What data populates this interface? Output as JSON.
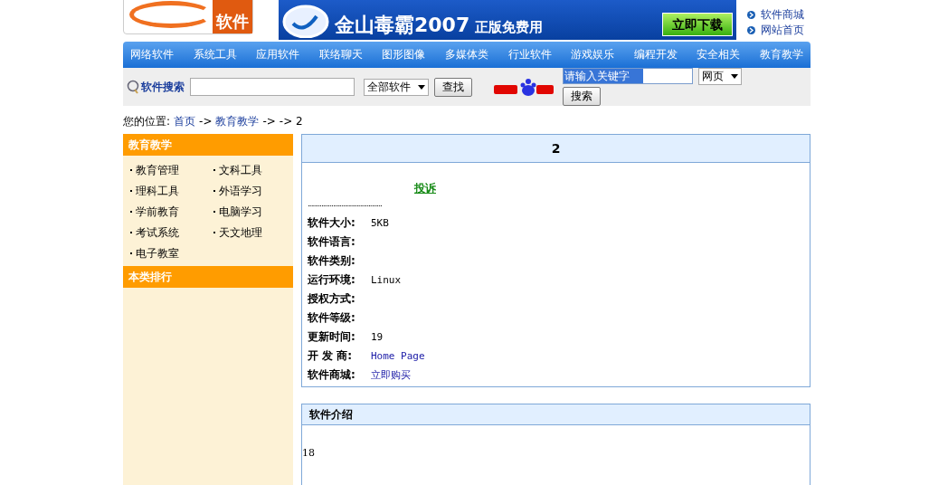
{
  "header": {
    "logo": {
      "text": "软件"
    },
    "ad": {
      "title": "金山毒霸2007",
      "subtitle": "正版免费用",
      "cta": "立即下载"
    },
    "links": [
      "软件商城",
      "网站首页"
    ]
  },
  "nav": [
    "网络软件",
    "系统工具",
    "应用软件",
    "联络聊天",
    "图形图像",
    "多媒体类",
    "行业软件",
    "游戏娱乐",
    "编程开发",
    "安全相关",
    "教育教学"
  ],
  "search": {
    "label": "软件搜索",
    "category": "全部软件",
    "button": "查找",
    "baidu_value": "请输入关键字",
    "baidu_scope": "网页",
    "baidu_button": "搜索"
  },
  "breadcrumb": {
    "prefix": "您的位置:",
    "parts": [
      {
        "text": "首页",
        "kind": "link"
      },
      {
        "text": "->",
        "kind": "separator"
      },
      {
        "text": "教育教学",
        "kind": "link"
      },
      {
        "text": "->",
        "kind": "separator"
      }
    ],
    "tail": "-> 2"
  },
  "sidebar": {
    "title": "教育教学",
    "items": [
      "教育管理",
      "文科工具",
      "理科工具",
      "外语学习",
      "学前教育",
      "电脑学习",
      "考试系统",
      "天文地理",
      "电子教室"
    ],
    "ranking_title": "本类排行"
  },
  "detail": {
    "title": "2",
    "report": "投诉",
    "dots": "............................................",
    "fields": [
      {
        "label": "软件大小:",
        "value": "5KB",
        "kind": "text"
      },
      {
        "label": "软件语言:"
      },
      {
        "label": "软件类别:"
      },
      {
        "label": "运行环境:",
        "value": "Linux",
        "kind": "text"
      },
      {
        "label": "授权方式:"
      },
      {
        "label": "软件等级:"
      },
      {
        "label": "更新时间:",
        "value": "19",
        "kind": "text"
      },
      {
        "label": "开 发 商:",
        "value": "Home Page",
        "kind": "link"
      },
      {
        "label": "软件商城:",
        "value": "立即购买",
        "kind": "link"
      }
    ]
  },
  "intro": {
    "title": "软件介绍",
    "body": "18"
  }
}
